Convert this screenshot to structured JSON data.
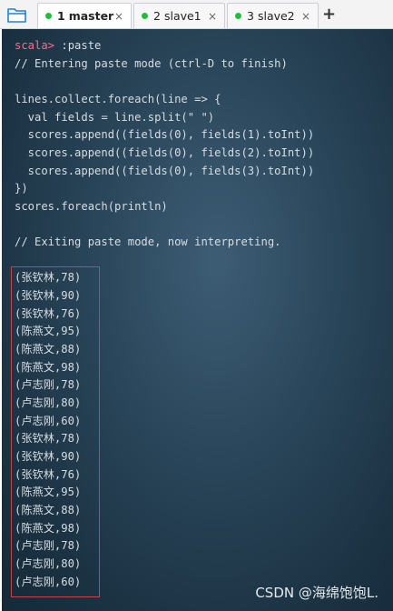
{
  "tabs": [
    {
      "index": "1",
      "label": "master",
      "dot_color": "#1fbf3a",
      "active": true,
      "close": "×"
    },
    {
      "index": "2",
      "label": "slave1",
      "dot_color": "#1fbf3a",
      "active": false,
      "close": "×"
    },
    {
      "index": "3",
      "label": "slave2",
      "dot_color": "#1fbf3a",
      "active": false,
      "close": "×"
    }
  ],
  "new_tab_label": "+",
  "terminal": {
    "prompt": "scala>",
    "command": " :paste",
    "lines": [
      "// Entering paste mode (ctrl-D to finish)",
      "",
      "lines.collect.foreach(line => {",
      "  val fields = line.split(\" \")",
      "  scores.append((fields(0), fields(1).toInt))",
      "  scores.append((fields(0), fields(2).toInt))",
      "  scores.append((fields(0), fields(3).toInt))",
      "})",
      "scores.foreach(println)",
      "",
      "// Exiting paste mode, now interpreting.",
      ""
    ],
    "output": [
      "(张钦林,78)",
      "(张钦林,90)",
      "(张钦林,76)",
      "(陈燕文,95)",
      "(陈燕文,88)",
      "(陈燕文,98)",
      "(卢志刚,78)",
      "(卢志刚,80)",
      "(卢志刚,60)",
      "(张钦林,78)",
      "(张钦林,90)",
      "(张钦林,76)",
      "(陈燕文,95)",
      "(陈燕文,88)",
      "(陈燕文,98)",
      "(卢志刚,78)",
      "(卢志刚,80)",
      "(卢志刚,60)"
    ]
  },
  "watermark": "CSDN @海绵饱饱L.",
  "colors": {
    "prompt": "#ff6a8a",
    "highlight_box": "#c9424a",
    "terminal_text": "#d7dde2"
  }
}
